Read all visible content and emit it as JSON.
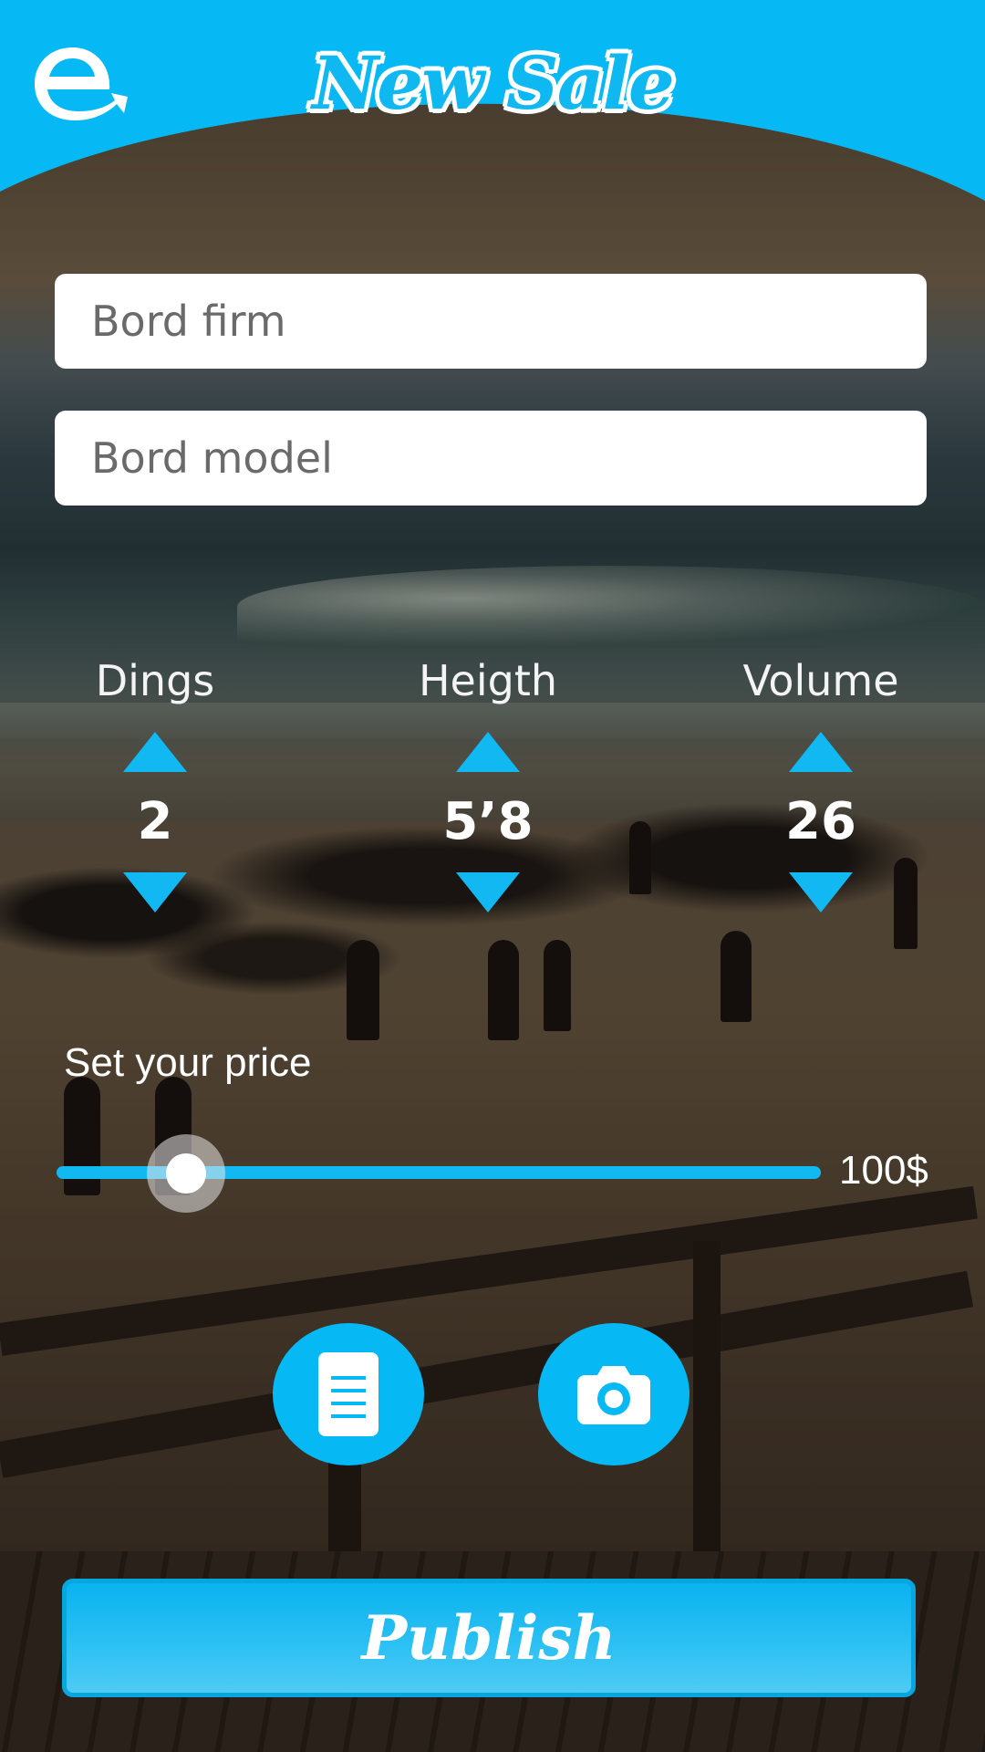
{
  "header": {
    "title": "New Sale",
    "logo_icon": "whale-e-logo-icon",
    "brand_color": "#06b9f4"
  },
  "form": {
    "board_firm_placeholder": "Bord firm",
    "board_model_placeholder": "Bord model"
  },
  "steppers": [
    {
      "label": "Dings",
      "value": "2"
    },
    {
      "label": "Heigth",
      "value": "5’8"
    },
    {
      "label": "Volume",
      "value": "26"
    }
  ],
  "price": {
    "label": "Set your price",
    "value_label": "100$",
    "slider_fraction": 0.17
  },
  "actions": {
    "document_icon": "document-icon",
    "camera_icon": "camera-icon",
    "publish_label": "Publish"
  }
}
